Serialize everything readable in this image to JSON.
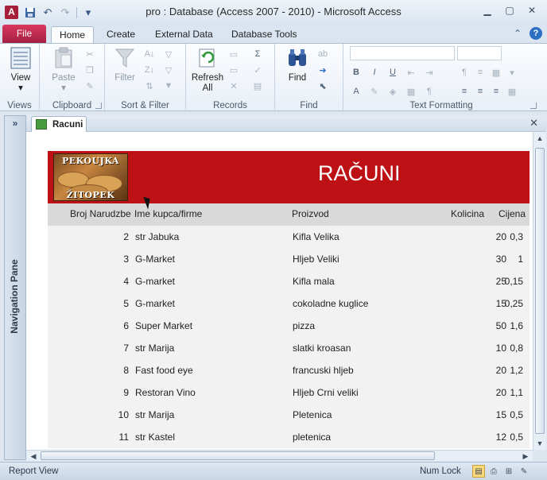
{
  "window": {
    "title": "pro : Database (Access 2007 - 2010)  -  Microsoft Access",
    "app_icon_letter": "A"
  },
  "ribbon_tabs": {
    "file": "File",
    "home": "Home",
    "create": "Create",
    "external": "External Data",
    "tools": "Database Tools"
  },
  "ribbon": {
    "views": {
      "label": "Views",
      "view_btn": "View"
    },
    "clipboard": {
      "label": "Clipboard",
      "paste_btn": "Paste"
    },
    "sort_filter": {
      "label": "Sort & Filter",
      "filter_btn": "Filter"
    },
    "records": {
      "label": "Records",
      "refresh_line1": "Refresh",
      "refresh_line2": "All"
    },
    "find": {
      "label": "Find",
      "find_btn": "Find"
    },
    "text_formatting": {
      "label": "Text Formatting"
    }
  },
  "document": {
    "tab_label": "Racuni"
  },
  "nav_pane": {
    "label": "Navigation Pane",
    "expand": "»"
  },
  "report": {
    "title": "RAČUNI",
    "logo_line1": "PEKOUJKA",
    "logo_line2": "ŽITOPEK",
    "columns": {
      "broj": "Broj Narudzbe",
      "ime": "Ime kupca/firme",
      "proizvod": "Proizvod",
      "kolicina": "Kolicina",
      "cijena": "Cijena"
    },
    "rows": [
      {
        "broj": "2",
        "ime": "str Jabuka",
        "proizvod": "Kifla Velika",
        "kolicina": "20",
        "cijena": "0,3"
      },
      {
        "broj": "3",
        "ime": "G-Market",
        "proizvod": "Hljeb Veliki",
        "kolicina": "30",
        "cijena": "1"
      },
      {
        "broj": "4",
        "ime": "G-market",
        "proizvod": "Kifla mala",
        "kolicina": "25",
        "cijena": "0,15"
      },
      {
        "broj": "5",
        "ime": "G-market",
        "proizvod": "cokoladne kuglice",
        "kolicina": "15",
        "cijena": "0,25"
      },
      {
        "broj": "6",
        "ime": "Super Market",
        "proizvod": "pizza",
        "kolicina": "50",
        "cijena": "1,6"
      },
      {
        "broj": "7",
        "ime": "str Marija",
        "proizvod": "slatki kroasan",
        "kolicina": "10",
        "cijena": "0,8"
      },
      {
        "broj": "8",
        "ime": "Fast food eye",
        "proizvod": "francuski hljeb",
        "kolicina": "20",
        "cijena": "1,2"
      },
      {
        "broj": "9",
        "ime": "Restoran Vino",
        "proizvod": "Hljeb Crni veliki",
        "kolicina": "20",
        "cijena": "1,1"
      },
      {
        "broj": "10",
        "ime": "str Marija",
        "proizvod": "Pletenica",
        "kolicina": "15",
        "cijena": "0,5"
      },
      {
        "broj": "11",
        "ime": "str Kastel",
        "proizvod": "pletenica",
        "kolicina": "12",
        "cijena": "0,5"
      }
    ]
  },
  "statusbar": {
    "left": "Report View",
    "numlock": "Num Lock"
  },
  "colors": {
    "banner": "#be1116",
    "file_tab": "#c02a4f",
    "header_row": "#d9d9d9",
    "row_bg": "#f2f2f2"
  }
}
